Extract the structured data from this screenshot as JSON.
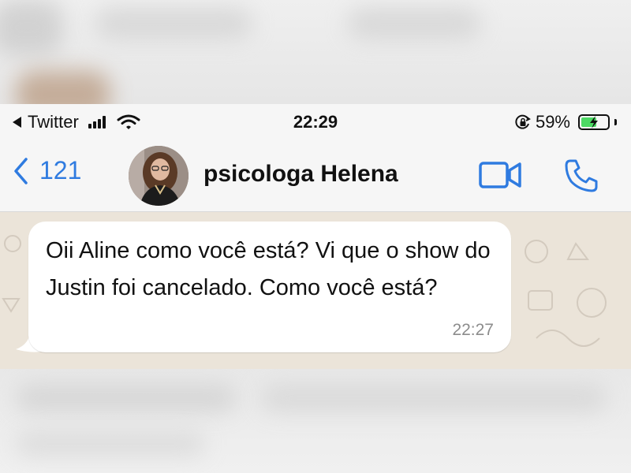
{
  "status_bar": {
    "back_app": "Twitter",
    "time": "22:29",
    "battery_percent": "59%",
    "battery_level": 0.59,
    "icons": [
      "back-triangle-icon",
      "cellular-signal-icon",
      "wifi-icon",
      "orientation-lock-icon",
      "battery-charging-icon"
    ]
  },
  "header": {
    "back_count": "121",
    "contact_name": "psicologa Helena",
    "icons": [
      "chevron-left-icon",
      "avatar",
      "video-call-icon",
      "phone-call-icon"
    ]
  },
  "messages": [
    {
      "direction": "incoming",
      "text": "Oii Aline como você está? Vi que o show do Justin foi cancelado. Como você está?",
      "time": "22:27"
    }
  ],
  "colors": {
    "ios_blue": "#2f7be0",
    "chat_background": "#ebe4d9",
    "bubble": "#ffffff",
    "battery_fill": "#4cd964"
  }
}
